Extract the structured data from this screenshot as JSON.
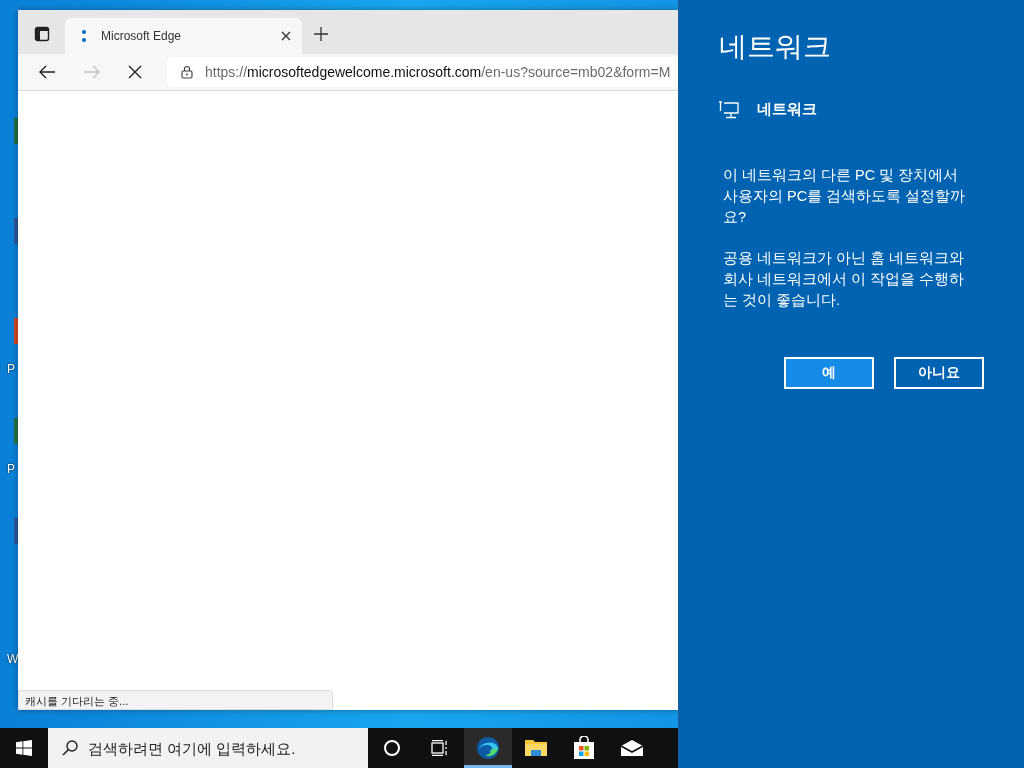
{
  "desktop": {
    "icons": [
      {
        "color": "#1e7145"
      },
      {
        "color": "#2b579a"
      },
      {
        "label": "P",
        "color": "#d24726"
      },
      {
        "label": "P",
        "color": "#217346"
      },
      {
        "color": "#2b579a"
      },
      {
        "label": "W"
      }
    ]
  },
  "browser": {
    "tabs": [
      {
        "title": "Microsoft Edge",
        "loading": true,
        "selected": true
      }
    ],
    "toolbar": {
      "forward_disabled": true,
      "loading": true
    },
    "address": {
      "scheme": "https://",
      "host": "microsoftedgewelcome.microsoft.com",
      "path": "/en-us?source=mb02&form=M"
    },
    "status": "캐시를 기다리는 중..."
  },
  "taskbar": {
    "search_placeholder": "검색하려면 여기에 입력하세요.",
    "apps": [
      {
        "kind": "cortana",
        "active": false
      },
      {
        "kind": "taskview",
        "active": false
      },
      {
        "kind": "edge",
        "active": true
      },
      {
        "kind": "explorer",
        "active": false
      },
      {
        "kind": "store",
        "active": false
      },
      {
        "kind": "mail",
        "active": false
      }
    ]
  },
  "panel": {
    "title": "네트워크",
    "network_name": "네트워크",
    "paragraphs": [
      "이 네트워크의 다른 PC 및 장치에서 사용자의 PC를 검색하도록 설정할까요?",
      "공용 네트워크가 아닌 홈 네트워크와 회사 네트워크에서 이 작업을 수행하는 것이 좋습니다."
    ],
    "buttons": [
      {
        "label": "예",
        "primary": true
      },
      {
        "label": "아니요",
        "primary": false
      }
    ]
  }
}
